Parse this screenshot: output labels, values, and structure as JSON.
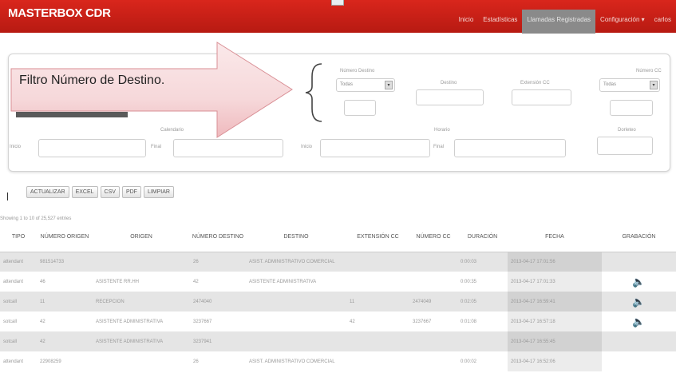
{
  "app": {
    "brand": "MASTERBOX CDR"
  },
  "nav": [
    {
      "label": "Inicio"
    },
    {
      "label": "Estadísticas"
    },
    {
      "label": "Llamadas Registradas",
      "active": true
    },
    {
      "label": "Configuración ▾"
    },
    {
      "label": "carlos"
    }
  ],
  "filters": {
    "numero_destino_label": "Número Destino",
    "numero_destino_select": "Todas",
    "destino_label": "Destino",
    "extension_cc_label": "Extensión CC",
    "numero_cc_label": "Número CC",
    "numero_cc_select": "Todas",
    "calendario_label": "Calendario",
    "inicio_label": "Inicio",
    "final_label": "Final",
    "horario_label": "Horario",
    "inicio2_label": "Inicio",
    "final2_label": "Final",
    "dorlabel": "Dorleteo"
  },
  "callout": {
    "text": "Filtro Número de Destino."
  },
  "buttons": [
    {
      "label": "ACTUALIZAR"
    },
    {
      "label": "EXCEL"
    },
    {
      "label": "CSV"
    },
    {
      "label": "PDF"
    },
    {
      "label": "LIMPIAR"
    }
  ],
  "table": {
    "showing": "Showing 1 to 10 of 25,527 entries",
    "headers": [
      "TIPO",
      "NÚMERO ORIGEN",
      "ORIGEN",
      "NÚMERO DESTINO",
      "DESTINO",
      "EXTENSIÓN CC",
      "NÚMERO CC",
      "DURACIÓN",
      "FECHA",
      "GRABACIÓN"
    ],
    "rows": [
      [
        "attendant",
        "981514733",
        "",
        "26",
        "ASIST. ADMINISTRATIVO COMERCIAL",
        "",
        "",
        "0:00:03",
        "2013-04-17 17:01:56",
        ""
      ],
      [
        "attendant",
        "46",
        "ASISTENTE RR.HH",
        "42",
        "ASISTENTE ADMINISTRATIVA",
        "",
        "",
        "0:00:35",
        "2013-04-17 17:01:33",
        "🔈"
      ],
      [
        "sotcall",
        "11",
        "RECEPCION",
        "2474040",
        "",
        "11",
        "2474049",
        "0:02:05",
        "2013-04-17 16:59:41",
        "🔈"
      ],
      [
        "sotcall",
        "42",
        "ASISTENTE ADMINISTRATIVA",
        "3237667",
        "",
        "42",
        "3237667",
        "0:01:08",
        "2013-04-17 16:57:18",
        "🔈"
      ],
      [
        "sotcall",
        "42",
        "ASISTENTE ADMINISTRATIVA",
        "3237941",
        "",
        "",
        "",
        "",
        "2013-04-17 16:55:45",
        ""
      ],
      [
        "attendant",
        "22908259",
        "",
        "26",
        "ASIST. ADMINISTRATIVO COMERCIAL",
        "",
        "",
        "0:00:02",
        "2013-04-17 16:52:06",
        ""
      ]
    ]
  }
}
